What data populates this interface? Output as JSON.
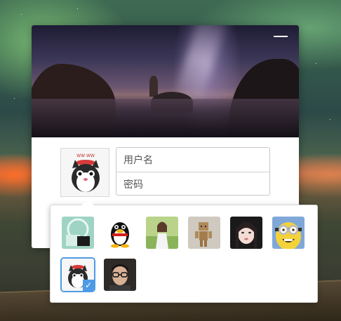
{
  "login": {
    "username_placeholder": "用户名",
    "password_placeholder": "密码"
  },
  "avatar_picker": {
    "avatars": [
      {
        "icon": "cartoon-cat-avatar",
        "selected": false
      },
      {
        "icon": "qq-penguin-avatar",
        "selected": false
      },
      {
        "icon": "girl-outdoor-avatar",
        "selected": false
      },
      {
        "icon": "cardboard-robot-avatar",
        "selected": false
      },
      {
        "icon": "girl-portrait-avatar",
        "selected": false
      },
      {
        "icon": "minion-avatar",
        "selected": false
      },
      {
        "icon": "cartoon-cat-avatar",
        "selected": true
      },
      {
        "icon": "boy-glasses-avatar",
        "selected": false
      }
    ],
    "check_mark": "✓"
  },
  "colors": {
    "accent": "#4d9be6",
    "border": "#c8c8c8"
  }
}
